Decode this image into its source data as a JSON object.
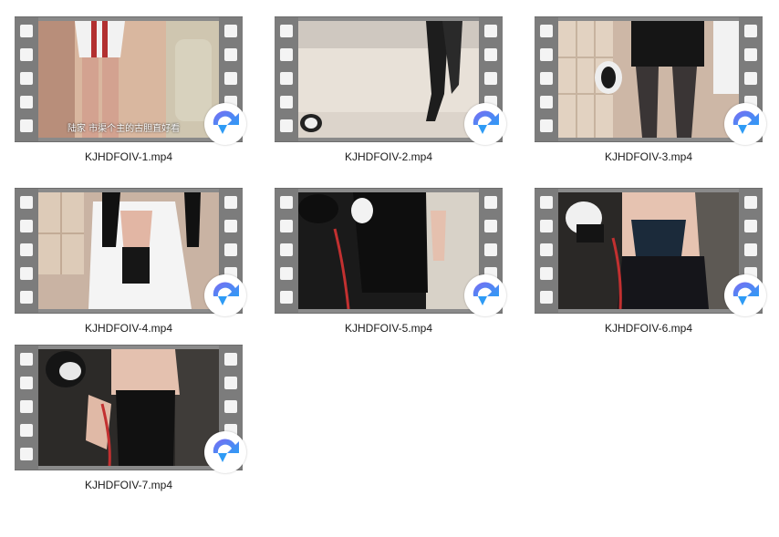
{
  "files": [
    {
      "name": "KJHDFOIV-1.mp4",
      "subtitle": "陆家 市渠个主的古胆直好看",
      "icon": "player-badge-icon"
    },
    {
      "name": "KJHDFOIV-2.mp4",
      "subtitle": "",
      "icon": "player-badge-icon"
    },
    {
      "name": "KJHDFOIV-3.mp4",
      "subtitle": "",
      "icon": "player-badge-icon"
    },
    {
      "name": "KJHDFOIV-4.mp4",
      "subtitle": "",
      "icon": "player-badge-icon"
    },
    {
      "name": "KJHDFOIV-5.mp4",
      "subtitle": "",
      "icon": "player-badge-icon"
    },
    {
      "name": "KJHDFOIV-6.mp4",
      "subtitle": "",
      "icon": "player-badge-icon"
    },
    {
      "name": "KJHDFOIV-7.mp4",
      "subtitle": "",
      "icon": "player-badge-icon"
    }
  ],
  "colors": {
    "background": "#ffffff",
    "film": "#8a8a8a",
    "sprocket": "#f4f4f4",
    "badge_gradient_start": "#7b6cf2",
    "badge_gradient_end": "#2f9bf5",
    "label_text": "#1a1a1a"
  }
}
